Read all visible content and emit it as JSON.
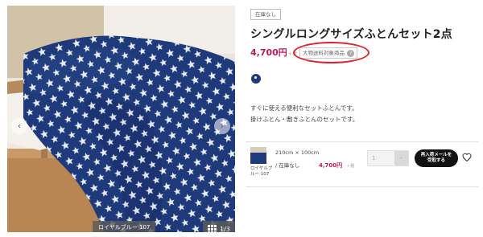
{
  "gallery": {
    "color_caption": "ロイヤルブルー 107",
    "counter": "1/3",
    "prev_icon": "chevron-left",
    "next_icon": "chevron-right",
    "prev_glyph": "‹",
    "next_glyph": "›",
    "grid_icon": "grid"
  },
  "product": {
    "stock_badge": "在庫なし",
    "title": "シングルロングサイズふとんセット2点",
    "price": "4,700円",
    "tax_note": "＋税",
    "shipping_badge": "大物送料対象商品",
    "help_glyph": "?",
    "swatch_color": "#1f3a7a",
    "description": [
      "すぐに使える便利なセットふとんです。",
      "掛けふとん・敷きふとんのセットです。"
    ]
  },
  "variant": {
    "name": "ロイヤルブルー 107",
    "size": "210cm × 100cm",
    "stock": "/ 在庫なし",
    "price": "4,700円",
    "tax_note": "＋税",
    "quantity_value": "1",
    "stepper_glyph": "-",
    "notify_label_line1": "再入荷メールを",
    "notify_label_line2": "受取する"
  },
  "colors": {
    "accent_price": "#c2185b",
    "annotation": "#e0202a",
    "navy": "#1f3a7a"
  }
}
